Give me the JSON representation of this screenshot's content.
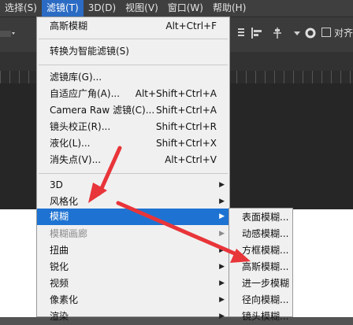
{
  "menubar": {
    "items": [
      {
        "label": "选择(S)"
      },
      {
        "label": "滤镜(T)"
      },
      {
        "label": "3D(D)"
      },
      {
        "label": "视图(V)"
      },
      {
        "label": "窗口(W)"
      },
      {
        "label": "帮助(H)"
      }
    ]
  },
  "options_bar": {
    "align_label": "对齐"
  },
  "filter_menu": {
    "last_filter": {
      "label": "高斯模糊",
      "shortcut": "Alt+Ctrl+F"
    },
    "smart_filters": {
      "label": "转换为智能滤镜(S)"
    },
    "filter_gallery": {
      "label": "滤镜库(G)..."
    },
    "adaptive_wide_angle": {
      "label": "自适应广角(A)...",
      "shortcut": "Alt+Shift+Ctrl+A"
    },
    "camera_raw": {
      "label": "Camera Raw 滤镜(C)...",
      "shortcut": "Shift+Ctrl+A"
    },
    "lens_correction": {
      "label": "镜头校正(R)...",
      "shortcut": "Shift+Ctrl+R"
    },
    "liquify": {
      "label": "液化(L)...",
      "shortcut": "Shift+Ctrl+X"
    },
    "vanishing_point": {
      "label": "消失点(V)...",
      "shortcut": "Alt+Ctrl+V"
    },
    "submenus": [
      {
        "label": "3D"
      },
      {
        "label": "风格化"
      },
      {
        "label": "模糊"
      },
      {
        "label": "模糊画廊"
      },
      {
        "label": "扭曲"
      },
      {
        "label": "锐化"
      },
      {
        "label": "视频"
      },
      {
        "label": "像素化"
      },
      {
        "label": "渲染"
      }
    ]
  },
  "blur_menu": {
    "items": [
      {
        "label": "表面模糊..."
      },
      {
        "label": "动感模糊..."
      },
      {
        "label": "方框模糊..."
      },
      {
        "label": "高斯模糊..."
      },
      {
        "label": "进一步模糊"
      },
      {
        "label": "径向模糊..."
      },
      {
        "label": "镜头模糊..."
      }
    ]
  },
  "colors": {
    "highlight": "#1e73d2",
    "menubar_active": "#2b6bc4",
    "arrow_red": "#e8353a"
  }
}
